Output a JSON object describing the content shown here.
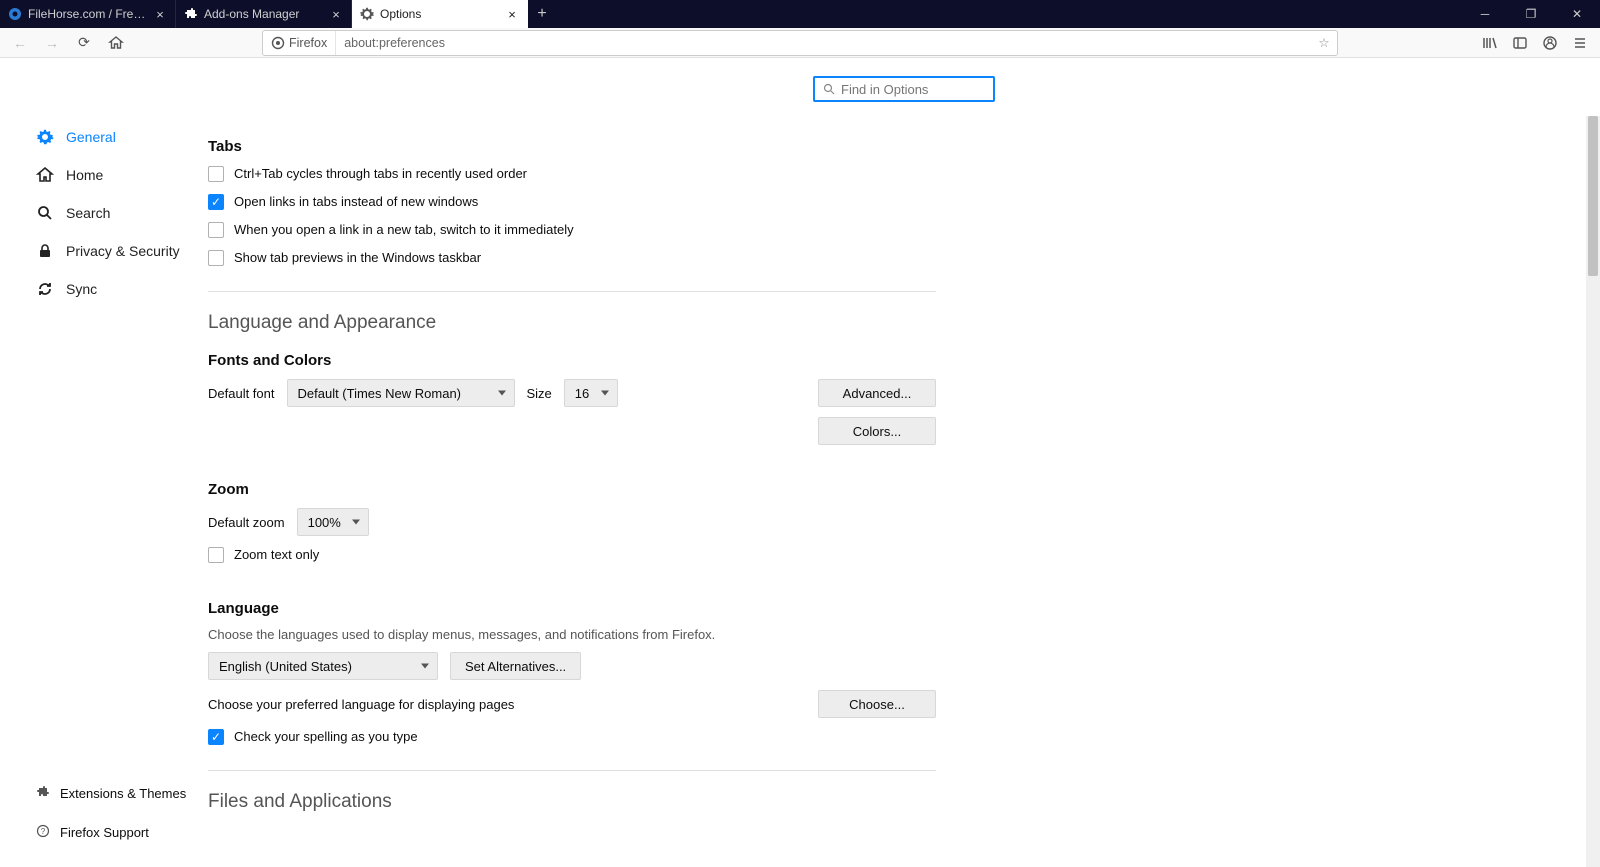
{
  "tabs": [
    {
      "title": "FileHorse.com / Free Software",
      "active": false
    },
    {
      "title": "Add-ons Manager",
      "active": false
    },
    {
      "title": "Options",
      "active": true
    }
  ],
  "url": {
    "identity": "Firefox",
    "address": "about:preferences"
  },
  "sidebar": {
    "items": [
      {
        "label": "General",
        "active": true
      },
      {
        "label": "Home"
      },
      {
        "label": "Search"
      },
      {
        "label": "Privacy & Security"
      },
      {
        "label": "Sync"
      }
    ],
    "bottom": [
      {
        "label": "Extensions & Themes"
      },
      {
        "label": "Firefox Support"
      }
    ]
  },
  "search": {
    "placeholder": "Find in Options"
  },
  "sections": {
    "tabs": {
      "title": "Tabs",
      "opts": [
        {
          "label": "Ctrl+Tab cycles through tabs in recently used order",
          "checked": false
        },
        {
          "label": "Open links in tabs instead of new windows",
          "checked": true
        },
        {
          "label": "When you open a link in a new tab, switch to it immediately",
          "checked": false
        },
        {
          "label": "Show tab previews in the Windows taskbar",
          "checked": false
        }
      ]
    },
    "lang_app": {
      "title": "Language and Appearance"
    },
    "fonts": {
      "title": "Fonts and Colors",
      "default_font_label": "Default font",
      "default_font_value": "Default (Times New Roman)",
      "size_label": "Size",
      "size_value": "16",
      "advanced": "Advanced...",
      "colors": "Colors..."
    },
    "zoom": {
      "title": "Zoom",
      "default_zoom_label": "Default zoom",
      "default_zoom_value": "100%",
      "text_only": {
        "label": "Zoom text only",
        "checked": false
      }
    },
    "language": {
      "title": "Language",
      "desc1": "Choose the languages used to display menus, messages, and notifications from Firefox.",
      "lang_value": "English (United States)",
      "set_alt": "Set Alternatives...",
      "desc2": "Choose your preferred language for displaying pages",
      "choose": "Choose...",
      "spell": {
        "label": "Check your spelling as you type",
        "checked": true
      }
    },
    "files": {
      "title": "Files and Applications"
    }
  }
}
